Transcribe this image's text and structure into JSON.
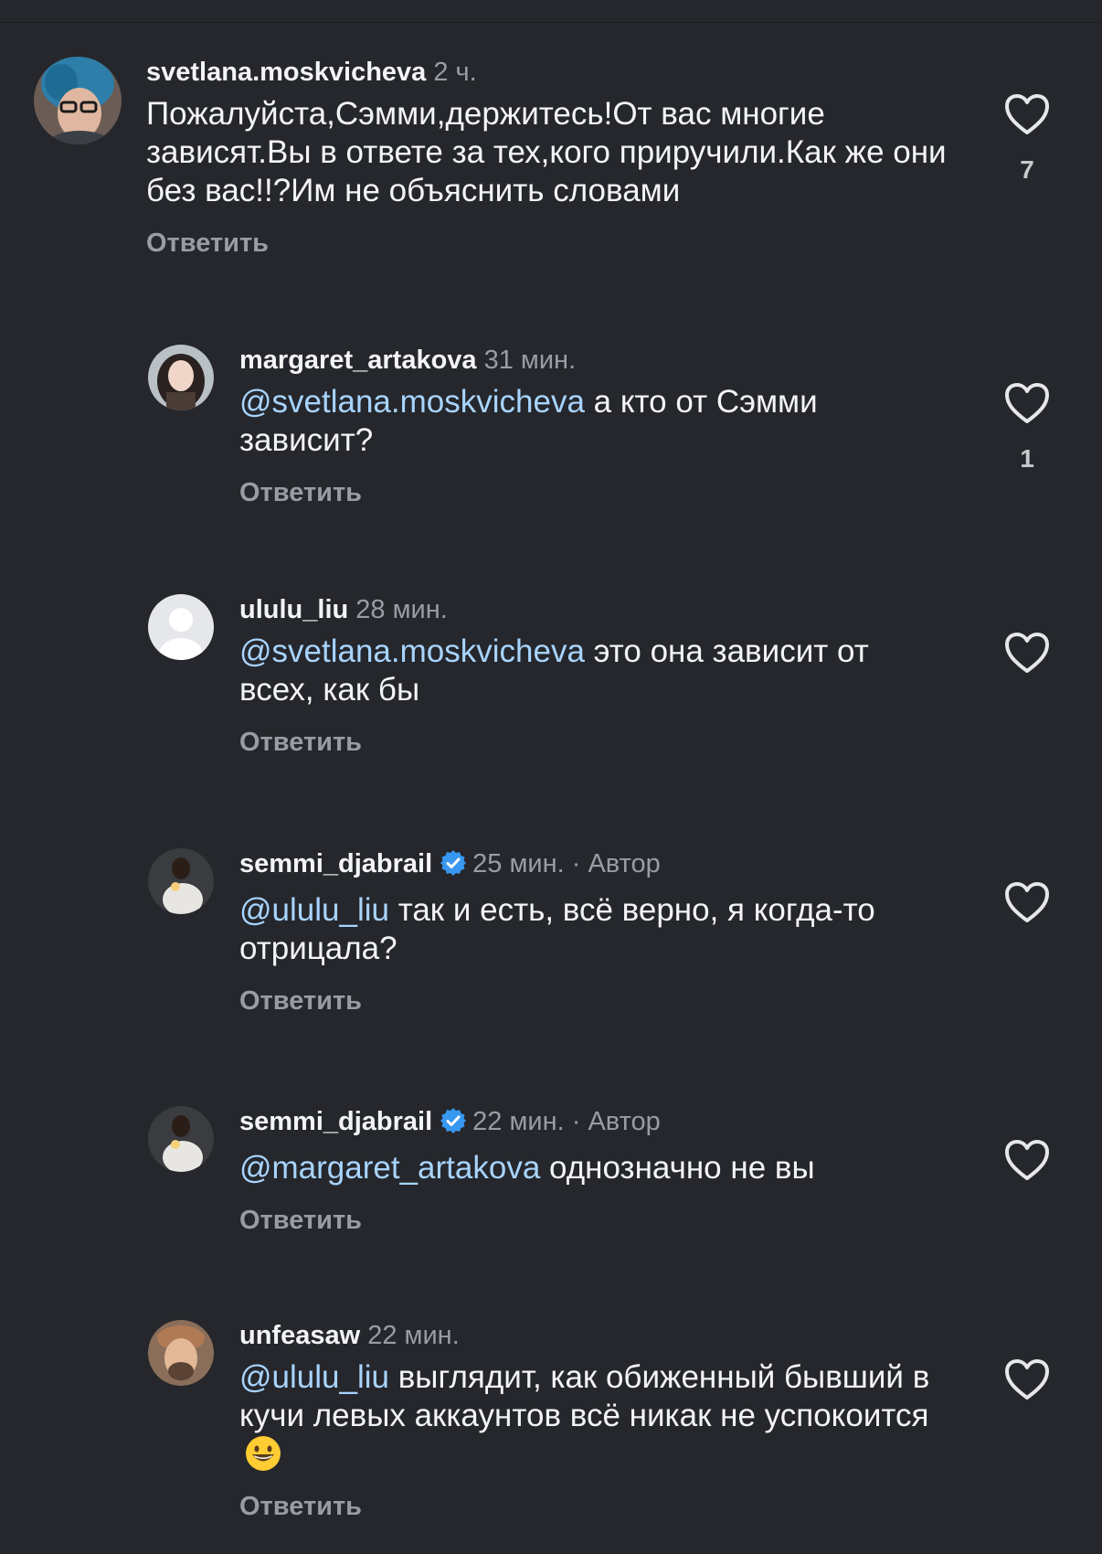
{
  "comments": [
    {
      "username": "svetlana.moskvicheva",
      "time": "2 ч.",
      "mention": "",
      "text": "Пожалуйста,Сэмми,держитесь!От вас многие зависят.Вы в ответе за тех,кого приручили.Как же они без вас!!?Им не объяснить словами",
      "reply": "Ответить",
      "likes": "7",
      "avatar": "avatar-blue-hair"
    },
    {
      "username": "margaret_artakova",
      "time": "31 мин.",
      "mention": "@svetlana.moskvicheva",
      "text": " а кто от Сэмми зависит?",
      "reply": "Ответить",
      "likes": "1",
      "avatar": "avatar-girl"
    },
    {
      "username": "ululu_liu",
      "time": "28 мин.",
      "mention": "@svetlana.moskvicheva",
      "text": " это она зависит от всех, как бы",
      "reply": "Ответить",
      "likes": "",
      "avatar": "default-avatar-icon"
    },
    {
      "username": "semmi_djabrail",
      "time": "25 мин.",
      "author": "· Автор",
      "mention": "@ululu_liu",
      "text": " так и есть, всё верно, я когда-то отрицала?",
      "reply": "Ответить",
      "likes": "",
      "avatar": "avatar-dark"
    },
    {
      "username": "semmi_djabrail",
      "time": "22 мин.",
      "author": "· Автор",
      "mention": "@margaret_artakova",
      "text": " однозначно не вы",
      "reply": "Ответить",
      "likes": "",
      "avatar": "avatar-dark"
    },
    {
      "username": "unfeasaw",
      "time": "22 мин.",
      "mention": "@ululu_liu",
      "text": " выглядит, как обиженный бывший в кучи левых аккаунтов всё никак не успокоится ",
      "emoji": "😄",
      "reply": "Ответить",
      "likes": "",
      "avatar": "avatar-man-cap"
    }
  ],
  "colors": {
    "background": "#25272c",
    "mention": "#a8d4ff",
    "muted": "#9a9ca3",
    "verified": "#3897f0"
  }
}
